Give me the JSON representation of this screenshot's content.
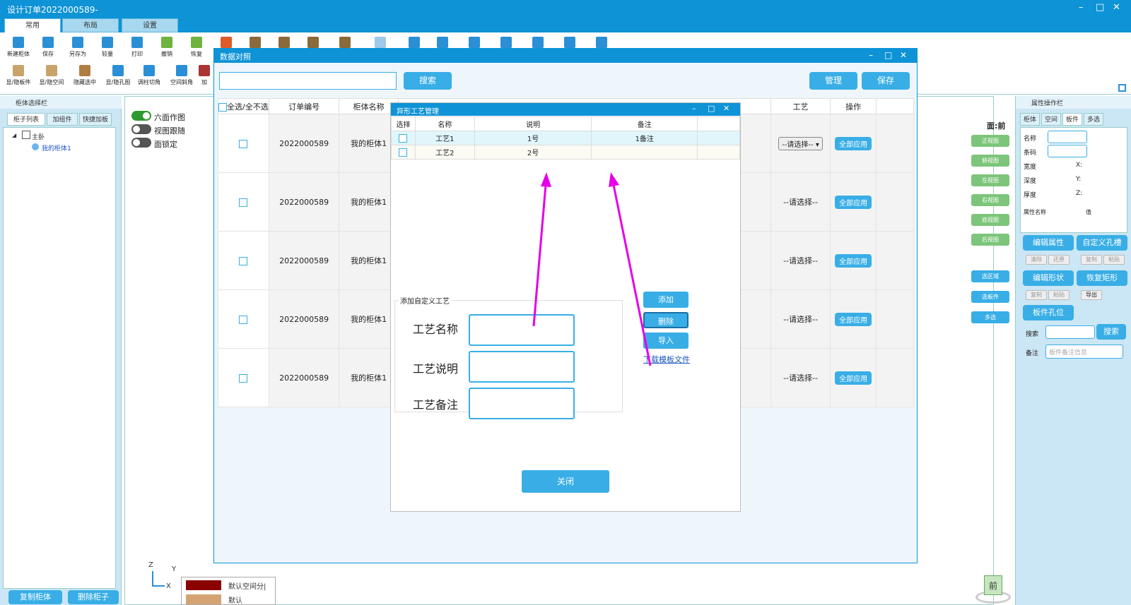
{
  "app": {
    "title": "设计订单2022000589-",
    "tabs": [
      "常用",
      "布局",
      "设置"
    ]
  },
  "ribbon": {
    "row1": [
      "新建柜体",
      "保存",
      "另存为",
      "较量",
      "打印",
      "撤销",
      "恢复"
    ],
    "row2": [
      "显/隐板件",
      "显/隐空间",
      "隐藏选中",
      "显/隐孔图",
      "调柱切角",
      "空间斜角",
      "加"
    ]
  },
  "left_panel": {
    "title": "柜体选择栏",
    "tabs": [
      "柜子列表",
      "加组件",
      "快捷加板"
    ],
    "tree_root": "主卧",
    "tree_child": "我的柜体1",
    "copy_button": "复制柜体",
    "delete_button": "删除柜子"
  },
  "view_toggles": [
    {
      "label": "六面作图",
      "on": true
    },
    {
      "label": "视图跟随",
      "on": false
    },
    {
      "label": "面锁定",
      "on": false
    }
  ],
  "right_views": {
    "face_label": "面:前",
    "views": [
      "正视图",
      "俯视图",
      "左视图",
      "右视图",
      "底视图",
      "后视图"
    ],
    "selects": [
      "选区域",
      "选板件",
      "多选"
    ]
  },
  "right_panel": {
    "title": "属性操作栏",
    "tabs": [
      "柜体",
      "空间",
      "板件",
      "多选"
    ],
    "fields": {
      "name": "名称",
      "barcode": "条码",
      "width": "宽度",
      "depth": "深度",
      "thickness": "厚度",
      "x": "X:",
      "y": "Y:",
      "z": "Z:"
    },
    "attr_header": "属性名称",
    "value_header": "值",
    "edit_attr": "编辑属性",
    "custom_hole": "自定义孔槽",
    "small1": [
      "清除",
      "还原",
      "复制",
      "粘贴"
    ],
    "edit_shape": "编辑形状",
    "restore_rect": "恢复矩形",
    "small2": [
      "复制",
      "粘贴",
      "导出"
    ],
    "board_hole": "板件孔位",
    "search_label": "搜索",
    "search_button": "搜索",
    "note_label": "备注",
    "note_placeholder": "板件备注信息"
  },
  "legend": [
    {
      "label": "默认空间分|",
      "color": "#8b0000"
    },
    {
      "label": "默认",
      "color": "#d4a373"
    }
  ],
  "axis": {
    "x": "X",
    "y": "Y",
    "z": "Z"
  },
  "cube_label": "前",
  "data_dialog": {
    "title": "数据对照",
    "search_button": "搜索",
    "manage_button": "管理",
    "save_button": "保存",
    "headers": [
      "全选/全不选",
      "订单编号",
      "柜体名称",
      "工艺",
      "操作"
    ],
    "rows": [
      {
        "order": "2022000589",
        "name": "我的柜体1",
        "craft": "--请选择--",
        "action": "全部应用"
      },
      {
        "order": "2022000589",
        "name": "我的柜体1",
        "craft": "--请选择--",
        "action": "全部应用"
      },
      {
        "order": "2022000589",
        "name": "我的柜体1",
        "craft": "--请选择--",
        "action": "全部应用"
      },
      {
        "order": "2022000589",
        "name": "我的柜体1",
        "craft": "--请选择--",
        "action": "全部应用"
      },
      {
        "order": "2022000589",
        "name": "我的柜体1",
        "craft": "--请选择--",
        "action": "全部应用"
      }
    ]
  },
  "craft_dialog": {
    "title": "异形工艺管理",
    "headers": [
      "选择",
      "名称",
      "说明",
      "备注"
    ],
    "rows": [
      {
        "name": "工艺1",
        "desc": "1号",
        "note": "1备注"
      },
      {
        "name": "工艺2",
        "desc": "2号",
        "note": ""
      }
    ],
    "group_title": "添加自定义工艺",
    "field_name": "工艺名称",
    "field_desc": "工艺说明",
    "field_note": "工艺备注",
    "add_button": "添加",
    "delete_button": "删除",
    "import_button": "导入",
    "download_link": "下载模板文件",
    "close_button": "关闭"
  }
}
